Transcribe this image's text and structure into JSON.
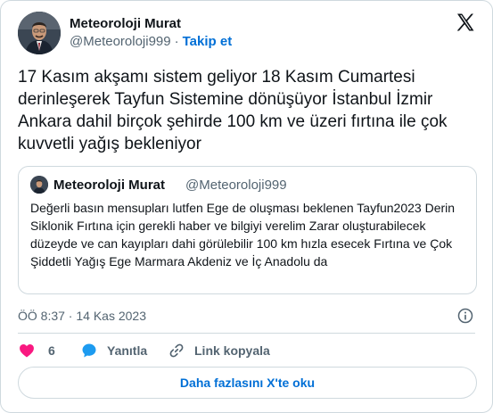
{
  "author": {
    "display_name": "Meteoroloji Murat",
    "handle": "@Meteoroloji999",
    "separator": "·",
    "follow_label": "Takip et"
  },
  "icons": {
    "logo": "x-logo-icon",
    "info": "info-icon",
    "like": "heart-icon",
    "reply": "speech-bubble-icon",
    "copy": "link-icon"
  },
  "colors": {
    "like": "#f91880",
    "reply": "#1d9bf0",
    "link": "#006fd6",
    "muted": "#536471",
    "border": "#cfd9de"
  },
  "tweet": {
    "text": "17 Kasım akşamı sistem geliyor 18 Kasım Cumartesi derinleşerek Tayfun Sistemine dönüşüyor İstanbul İzmir Ankara dahil birçok şehirde 100 km ve üzeri fırtına ile çok kuvvetli yağış bekleniyor",
    "timestamp": "ÖÖ 8:37 · 14 Kas 2023"
  },
  "quote": {
    "display_name": "Meteoroloji Murat",
    "handle": "@Meteoroloji999",
    "text": "Değerli basın mensupları lutfen Ege de oluşması beklenen Tayfun2023 Derin Siklonik Fırtına için gerekli haber ve bilgiyi verelim Zarar oluşturabilecek düzeyde ve can kayıpları dahi görülebilir 100 km hızla esecek  Fırtına ve Çok Şiddetli Yağış Ege Marmara Akdeniz ve İç Anadolu da"
  },
  "actions": {
    "like_count": "6",
    "reply_label": "Yanıtla",
    "copy_label": "Link kopyala"
  },
  "read_more": "Daha fazlasını X'te oku"
}
